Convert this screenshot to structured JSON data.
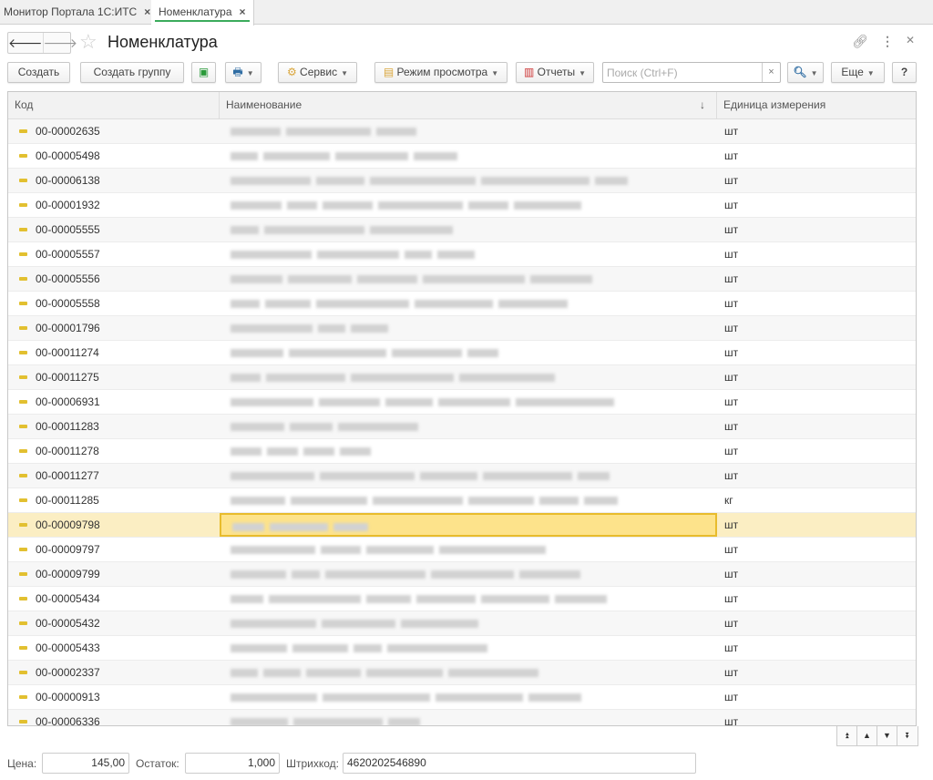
{
  "tabs": [
    {
      "label": "Монитор Портала 1С:ИТС",
      "close": "×"
    },
    {
      "label": "Номенклатура",
      "close": "×"
    }
  ],
  "header": {
    "title": "Номенклатура"
  },
  "toolbar": {
    "create": "Создать",
    "create_group": "Создать группу",
    "service": "Сервис",
    "view_mode": "Режим просмотра",
    "reports": "Отчеты",
    "search_placeholder": "Поиск (Ctrl+F)",
    "search_clear": "×",
    "more": "Еще",
    "help": "?"
  },
  "columns": {
    "code": "Код",
    "name": "Наименование",
    "sort": "↓",
    "unit": "Единица измерения"
  },
  "rows": [
    {
      "code": "00-00002635",
      "unit": "шт"
    },
    {
      "code": "00-00005498",
      "unit": "шт"
    },
    {
      "code": "00-00006138",
      "unit": "шт"
    },
    {
      "code": "00-00001932",
      "unit": "шт"
    },
    {
      "code": "00-00005555",
      "unit": "шт"
    },
    {
      "code": "00-00005557",
      "unit": "шт"
    },
    {
      "code": "00-00005556",
      "unit": "шт"
    },
    {
      "code": "00-00005558",
      "unit": "шт"
    },
    {
      "code": "00-00001796",
      "unit": "шт"
    },
    {
      "code": "00-00011274",
      "unit": "шт"
    },
    {
      "code": "00-00011275",
      "unit": "шт"
    },
    {
      "code": "00-00006931",
      "unit": "шт"
    },
    {
      "code": "00-00011283",
      "unit": "шт"
    },
    {
      "code": "00-00011278",
      "unit": "шт"
    },
    {
      "code": "00-00011277",
      "unit": "шт"
    },
    {
      "code": "00-00011285",
      "unit": "кг"
    },
    {
      "code": "00-00009798",
      "unit": "шт"
    },
    {
      "code": "00-00009797",
      "unit": "шт"
    },
    {
      "code": "00-00009799",
      "unit": "шт"
    },
    {
      "code": "00-00005434",
      "unit": "шт"
    },
    {
      "code": "00-00005432",
      "unit": "шт"
    },
    {
      "code": "00-00005433",
      "unit": "шт"
    },
    {
      "code": "00-00002337",
      "unit": "шт"
    },
    {
      "code": "00-00000913",
      "unit": "шт"
    },
    {
      "code": "00-00006336",
      "unit": "шт"
    }
  ],
  "selected_index": 16,
  "footer": {
    "price_label": "Цена:",
    "price": "145,00",
    "stock_label": "Остаток:",
    "stock": "1,000",
    "barcode_label": "Штрихкод:",
    "barcode": "4620202546890"
  }
}
